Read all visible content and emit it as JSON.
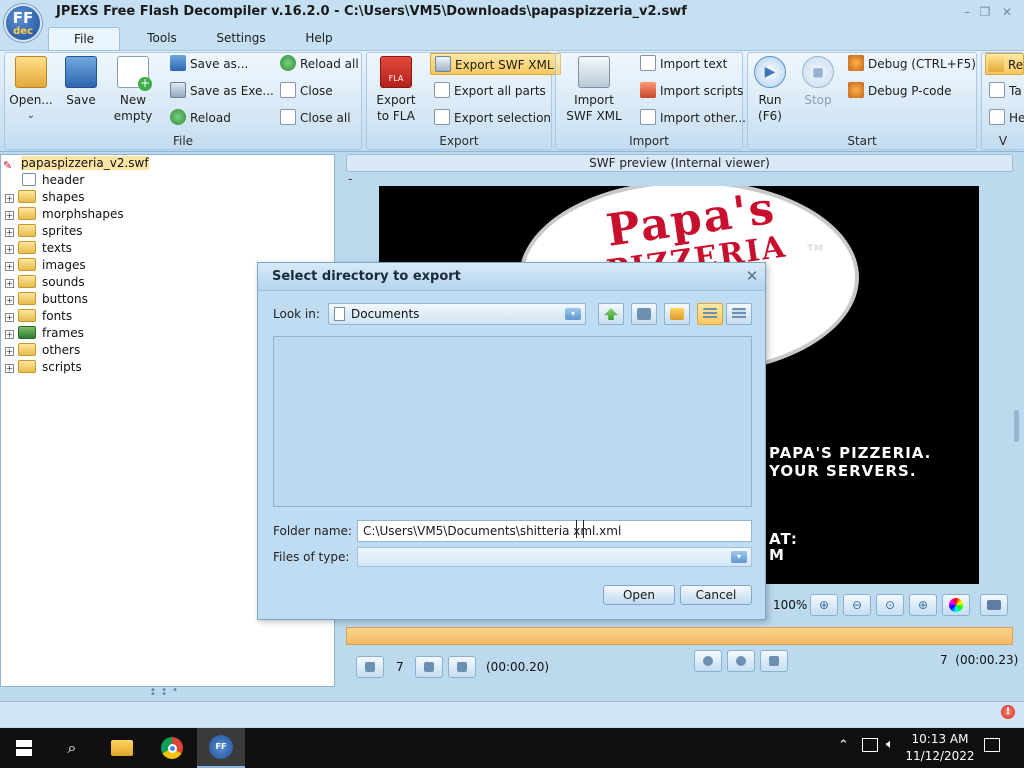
{
  "window": {
    "title": "JPEXS Free Flash Decompiler v.16.2.0 - C:\\Users\\VM5\\Downloads\\papaspizzeria_v2.swf",
    "logo_text": "FF",
    "logo_sub": "dec",
    "minimize": "–",
    "restore": "❐",
    "close": "✕"
  },
  "menu_tabs": [
    "File",
    "Tools",
    "Settings",
    "Help"
  ],
  "ribbon": {
    "file_group": {
      "label": "File",
      "open": "Open...",
      "save": "Save",
      "new_empty_line1": "New",
      "new_empty_line2": "empty",
      "save_as": "Save as...",
      "save_as_exe": "Save as Exe...",
      "reload": "Reload",
      "reload_all": "Reload all",
      "close": "Close",
      "close_all": "Close all"
    },
    "export_group": {
      "label": "Export",
      "export_fla_line1": "Export",
      "export_fla_line2": "to FLA",
      "export_swf_xml": "Export SWF XML",
      "export_all_parts": "Export all parts",
      "export_selection": "Export selection"
    },
    "import_group": {
      "label": "Import",
      "import_swf_xml_line1": "Import",
      "import_swf_xml_line2": "SWF XML",
      "import_text": "Import text",
      "import_scripts": "Import scripts",
      "import_other": "Import other..."
    },
    "start_group": {
      "label": "Start",
      "run_line1": "Run",
      "run_line2": "(F6)",
      "stop": "Stop",
      "debug": "Debug (CTRL+F5)",
      "debug_pcode": "Debug P-code"
    },
    "partial_group": {
      "items": [
        "Re",
        "Ta",
        "He"
      ],
      "label": "V"
    }
  },
  "tree": {
    "root": "papaspizzeria_v2.swf",
    "nodes": [
      "header",
      "shapes",
      "morphshapes",
      "sprites",
      "texts",
      "images",
      "sounds",
      "buttons",
      "fonts",
      "frames",
      "others",
      "scripts"
    ]
  },
  "preview": {
    "header": "SWF preview (Internal viewer)",
    "dash": "-",
    "logo_line1": "Papa's",
    "logo_line2": "PIZZERIA",
    "tm": "TM",
    "text_line1": "PAPA'S PIZZERIA.",
    "text_line2": "YOUR SERVERS.",
    "text_line3": "AT:",
    "text_line4": "M",
    "zoom": "100%",
    "frame_left": "7",
    "time_left": "(00:00.20)",
    "frame_right_label": "7  (00:00.23)"
  },
  "dialog": {
    "title": "Select directory to export",
    "look_in_label": "Look in:",
    "look_in_value": "Documents",
    "folder_name_label": "Folder name:",
    "folder_name_value": "C:\\Users\\VM5\\Documents\\shitteria xml.xml",
    "files_of_type_label": "Files of type:",
    "files_of_type_value": "",
    "open_button": "Open",
    "cancel_button": "Cancel"
  },
  "taskbar": {
    "time": "10:13 AM",
    "date": "11/12/2022"
  },
  "colors": {
    "window_bg": "#bcd9ee",
    "highlight": "#f8c860",
    "timeline": "#f5b766",
    "taskbar": "#101010"
  }
}
